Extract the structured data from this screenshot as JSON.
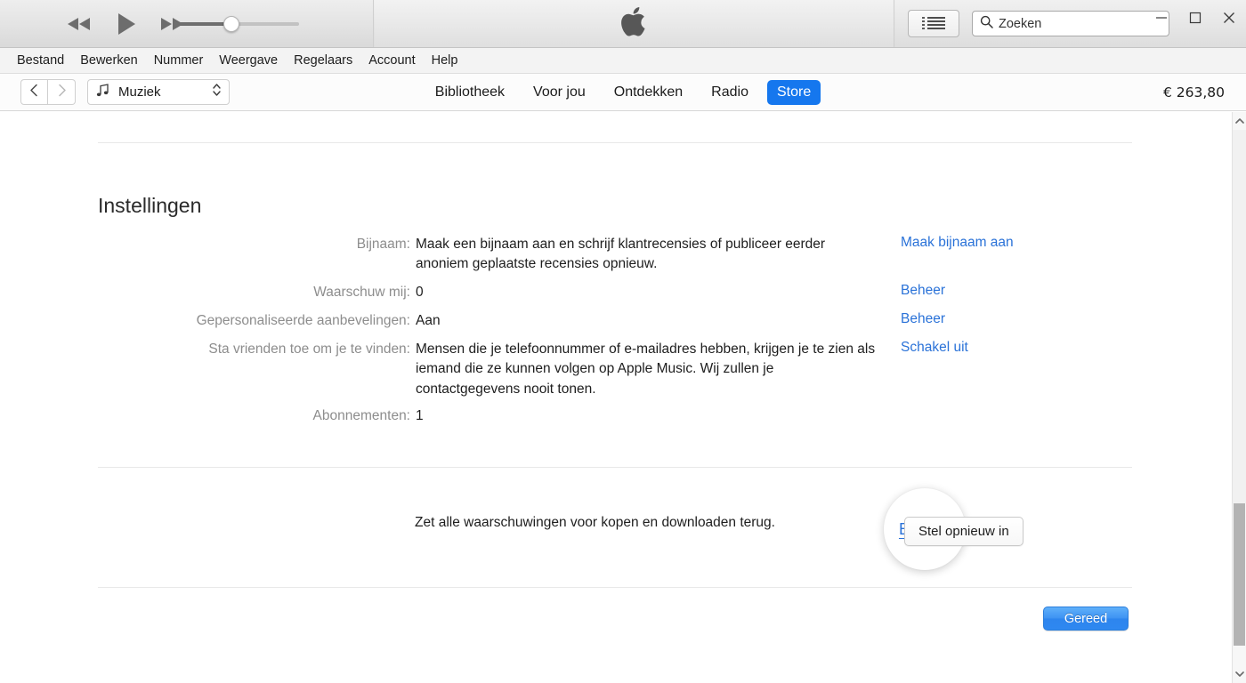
{
  "titlebar": {
    "transport": {
      "rewind": "rewind-icon",
      "play": "play-icon",
      "forward": "fast-forward-icon"
    },
    "volume": {
      "value": 44,
      "min": 0,
      "max": 100
    },
    "logo": "apple-logo",
    "list_button": "list-view-icon",
    "search": {
      "placeholder": "Zoeken",
      "value": "",
      "icon": "search-icon"
    },
    "window_controls": {
      "minimize": "minimize-icon",
      "maximize": "maximize-icon",
      "close": "close-icon"
    }
  },
  "menubar": {
    "items": [
      {
        "label": "Bestand"
      },
      {
        "label": "Bewerken"
      },
      {
        "label": "Nummer"
      },
      {
        "label": "Weergave"
      },
      {
        "label": "Regelaars"
      },
      {
        "label": "Account"
      },
      {
        "label": "Help"
      }
    ]
  },
  "navbar": {
    "back": "chevron-left-icon",
    "forward": "chevron-right-icon",
    "source": {
      "label": "Muziek",
      "icon": "music-note-icon",
      "stepper": "chevron-updown-icon"
    },
    "tabs": [
      {
        "label": "Bibliotheek",
        "active": false
      },
      {
        "label": "Voor jou",
        "active": false
      },
      {
        "label": "Ontdekken",
        "active": false
      },
      {
        "label": "Radio",
        "active": false
      },
      {
        "label": "Store",
        "active": true
      }
    ],
    "credit": "€ 263,80"
  },
  "main": {
    "section_title": "Instellingen",
    "rows": [
      {
        "label": "Bijnaam:",
        "value": "Maak een bijnaam aan en schrijf klantrecensies of publiceer eerder anoniem geplaatste recensies opnieuw.",
        "action": "Maak bijnaam aan"
      },
      {
        "label": "Waarschuw mij:",
        "value": "0",
        "action": "Beheer"
      },
      {
        "label": "Gepersonaliseerde aanbevelingen:",
        "value": "Aan",
        "action": "Beheer"
      },
      {
        "label": "Sta vrienden toe om je te vinden:",
        "value": "Mensen die je telefoonnummer of e-mailadres hebben, krijgen je te zien als iemand die ze kunnen volgen op Apple Music. Wij zullen je contactgegevens nooit tonen.",
        "action": "Schakel uit"
      },
      {
        "label": "Abonnementen:",
        "value": "1",
        "action": ""
      }
    ],
    "highlighted_action": "Beheer",
    "reset": {
      "text": "Zet alle waarschuwingen voor kopen en downloaden terug.",
      "button": "Stel opnieuw in"
    },
    "done_button": "Gereed"
  },
  "scrollbar": {
    "up_arrow": "chevron-up-icon",
    "down_arrow": "chevron-down-icon",
    "thumb": "scrollbar-thumb"
  },
  "colors": {
    "accent_blue": "#1577ee",
    "link_blue": "#2a72d8",
    "label_gray": "#8d8d8d",
    "text_dark": "#1e1e1e"
  }
}
